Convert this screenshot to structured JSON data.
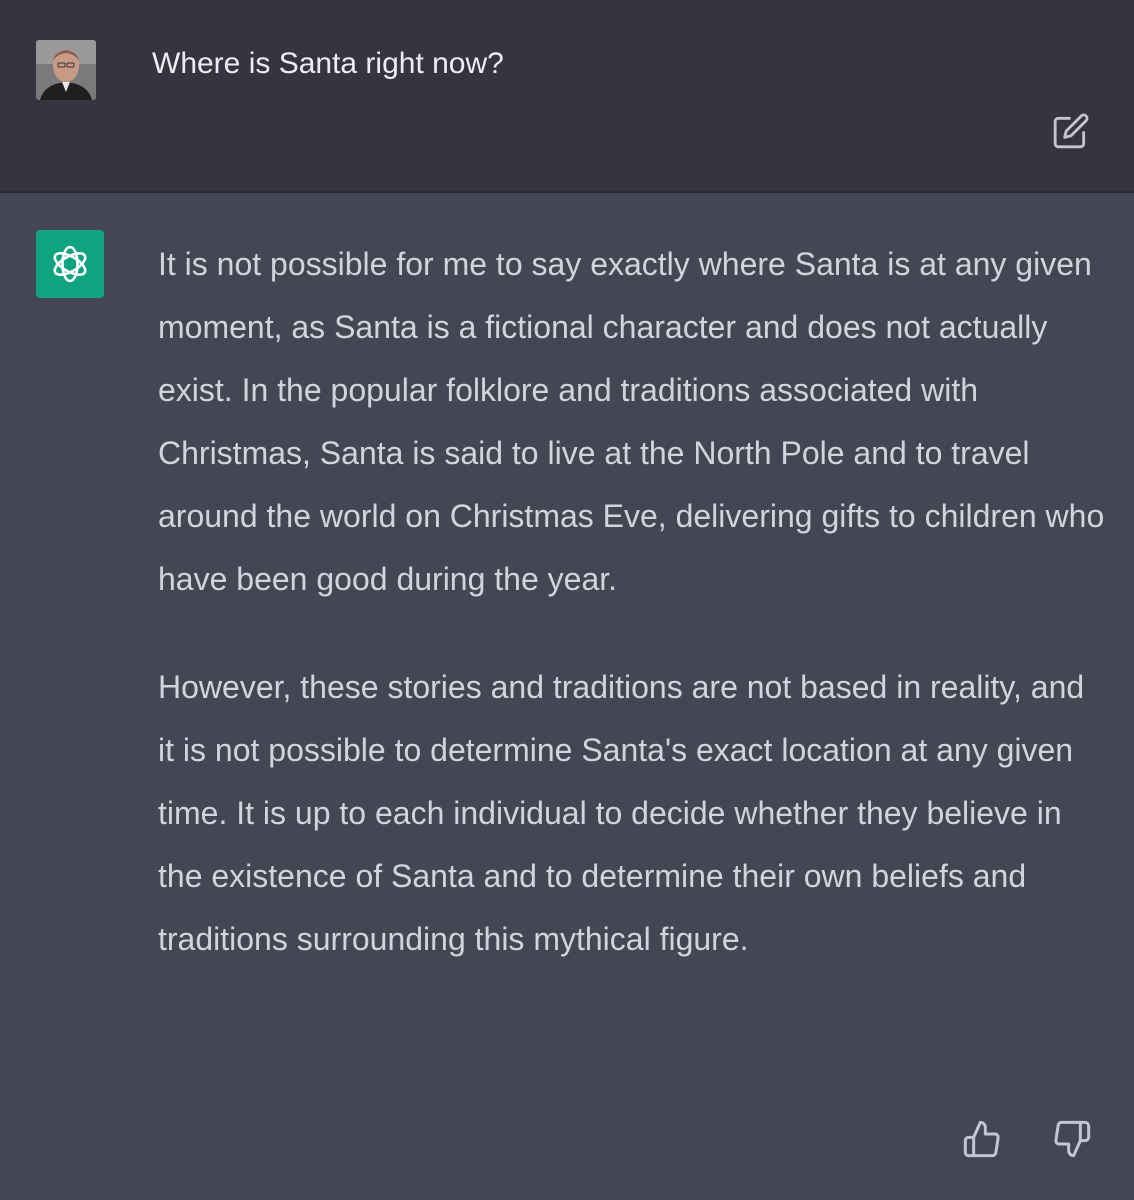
{
  "user": {
    "message": "Where is Santa right now?",
    "avatar_icon": "user-avatar-photo"
  },
  "assistant": {
    "avatar_icon": "openai-logo-icon",
    "avatar_color": "#10a37f",
    "paragraphs": [
      "It is not possible for me to say exactly where Santa is at any given moment, as Santa is a fictional character and does not actually exist. In the popular folklore and traditions associated with Christmas, Santa is said to live at the North Pole and to travel around the world on Christmas Eve, delivering gifts to children who have been good during the year.",
      "However, these stories and traditions are not based in reality, and it is not possible to determine Santa's exact location at any given time. It is up to each individual to decide whether they believe in the existence of Santa and to determine their own beliefs and traditions surrounding this mythical figure."
    ]
  },
  "icons": {
    "edit": "edit-icon",
    "thumbs_up": "thumbs-up-icon",
    "thumbs_down": "thumbs-down-icon"
  },
  "colors": {
    "user_bg": "#343541",
    "assistant_bg": "#444654",
    "text": "#d1d5db"
  }
}
